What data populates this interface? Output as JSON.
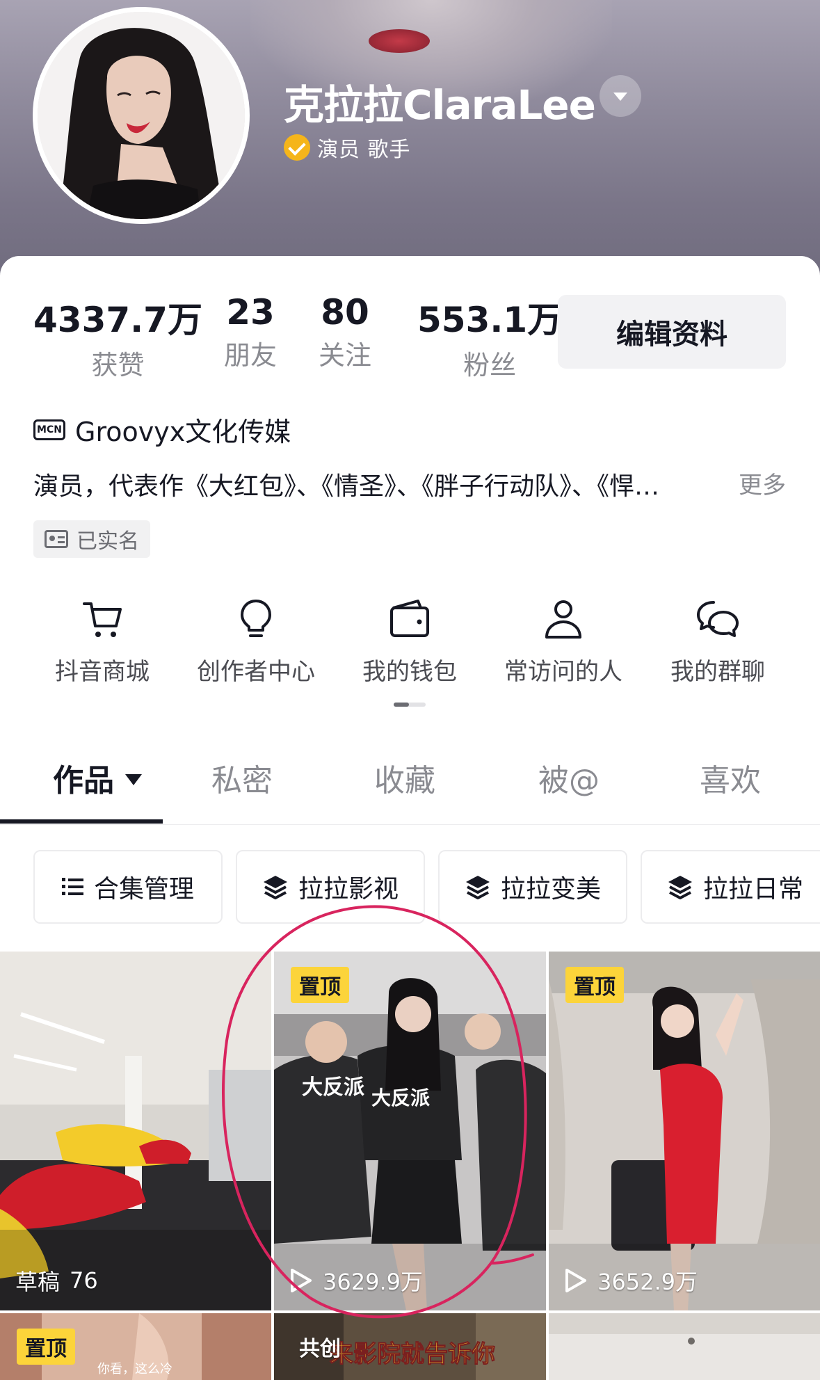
{
  "profile": {
    "name": "克拉拉ClaraLee",
    "verification": "演员 歌手",
    "accent_color": "#f5b51a"
  },
  "stats": [
    {
      "value": "4337.7万",
      "label": "获赞"
    },
    {
      "value": "23",
      "label": "朋友"
    },
    {
      "value": "80",
      "label": "关注"
    },
    {
      "value": "553.1万",
      "label": "粉丝"
    }
  ],
  "actions": {
    "edit_profile": "编辑资料"
  },
  "mcn": {
    "badge": "MCN",
    "name": "Groovyx文化传媒"
  },
  "bio": {
    "text": "演员，代表作《大红包》、《情圣》、《胖子行动队》、《悍…",
    "more": "更多"
  },
  "real_name": "已实名",
  "tools": [
    {
      "label": "抖音商城",
      "icon": "cart-icon"
    },
    {
      "label": "创作者中心",
      "icon": "lightbulb-icon"
    },
    {
      "label": "我的钱包",
      "icon": "wallet-icon"
    },
    {
      "label": "常访问的人",
      "icon": "person-icon"
    },
    {
      "label": "我的群聊",
      "icon": "chat-bubbles-icon"
    }
  ],
  "tabs": [
    "作品",
    "私密",
    "收藏",
    "被@",
    "喜欢"
  ],
  "collections": [
    {
      "label": "合集管理",
      "icon": "list-icon"
    },
    {
      "label": "拉拉影视",
      "icon": "layers-icon"
    },
    {
      "label": "拉拉变美",
      "icon": "layers-icon"
    },
    {
      "label": "拉拉日常",
      "icon": "layers-icon"
    }
  ],
  "videos": [
    {
      "badge": "",
      "label": "草稿",
      "count": "76"
    },
    {
      "badge": "置顶",
      "views": "3629.9万"
    },
    {
      "badge": "置顶",
      "views": "3652.9万"
    },
    {
      "badge": "置顶"
    },
    {
      "badge": "共创"
    },
    {
      "badge": ""
    }
  ],
  "highlight_color": "#d8245e"
}
